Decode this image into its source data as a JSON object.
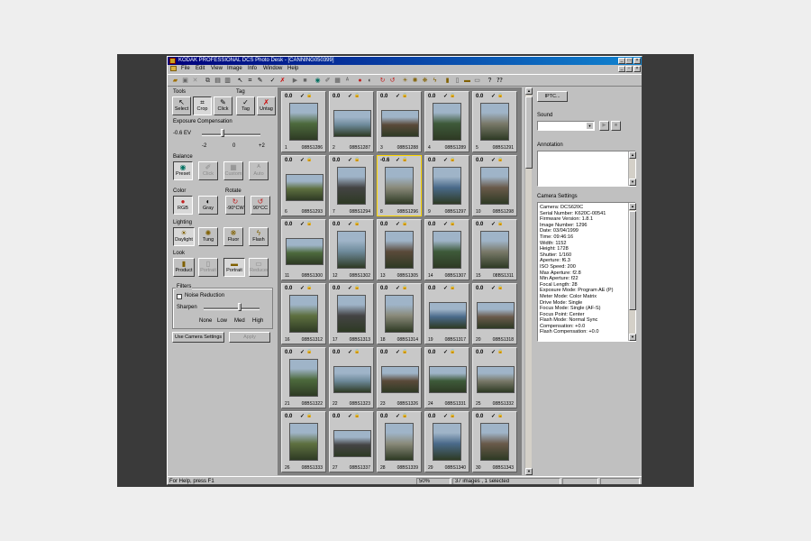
{
  "window": {
    "title": "KODAK PROFESSIONAL DCS Photo Desk - [CANNING050399]"
  },
  "menu": [
    "File",
    "Edit",
    "View",
    "Image",
    "Info",
    "Window",
    "Help"
  ],
  "tools": {
    "tools_label": "Tools",
    "tag_label": "Tag",
    "select": "Select",
    "crop": "Crop",
    "click": "Click",
    "tag": "Tag",
    "untag": "Untag"
  },
  "exposure": {
    "label": "Exposure Compensation",
    "value": "-0.6 EV",
    "ticks": [
      "-2",
      "0",
      "+2"
    ],
    "level": -0.6
  },
  "balance": {
    "label": "Balance",
    "buttons": [
      "Preset",
      "Click",
      "Custom",
      "Auto"
    ]
  },
  "color": {
    "label": "Color",
    "buttons": [
      "RGB",
      "Gray"
    ]
  },
  "rotate": {
    "label": "Rotate",
    "buttons": [
      "-90°CW",
      "90°CC"
    ]
  },
  "lighting": {
    "label": "Lighting",
    "buttons": [
      "Daylight",
      "Tung",
      "Fluor",
      "Flash"
    ]
  },
  "look": {
    "label": "Look",
    "buttons": [
      "Product",
      "Portrait",
      "Portrait",
      "Reduced"
    ]
  },
  "filters": {
    "label": "Filters",
    "noise": "Noise Reduction",
    "sharpen": "Sharpen",
    "levels": [
      "None",
      "Low",
      "Med",
      "High"
    ]
  },
  "actions": {
    "use_camera": "Use Camera Settings",
    "apply": "Apply"
  },
  "thumbnails": [
    {
      "n": "1",
      "f": "08BS1286",
      "ev": "0.0"
    },
    {
      "n": "2",
      "f": "08BS1287",
      "ev": "0.0"
    },
    {
      "n": "3",
      "f": "08BS1288",
      "ev": "0.0"
    },
    {
      "n": "4",
      "f": "08BS1289",
      "ev": "0.0"
    },
    {
      "n": "5",
      "f": "08BS1291",
      "ev": "0.0"
    },
    {
      "n": "6",
      "f": "08BS1293",
      "ev": "0.0"
    },
    {
      "n": "7",
      "f": "08BS1294",
      "ev": "0.0"
    },
    {
      "n": "8",
      "f": "08BS1296",
      "ev": "-0.6"
    },
    {
      "n": "9",
      "f": "08BS1297",
      "ev": "0.0"
    },
    {
      "n": "10",
      "f": "08BS1298",
      "ev": "0.0"
    },
    {
      "n": "11",
      "f": "08BS1300",
      "ev": "0.0"
    },
    {
      "n": "12",
      "f": "08BS1302",
      "ev": "0.0"
    },
    {
      "n": "13",
      "f": "08BS1305",
      "ev": "0.0"
    },
    {
      "n": "14",
      "f": "08BS1307",
      "ev": "0.0"
    },
    {
      "n": "15",
      "f": "08BS1311",
      "ev": "0.0"
    },
    {
      "n": "16",
      "f": "08BS1312",
      "ev": "0.0"
    },
    {
      "n": "17",
      "f": "08BS1313",
      "ev": "0.0"
    },
    {
      "n": "18",
      "f": "08BS1314",
      "ev": "0.0"
    },
    {
      "n": "19",
      "f": "08BS1317",
      "ev": "0.0"
    },
    {
      "n": "20",
      "f": "08BS1318",
      "ev": "0.0"
    },
    {
      "n": "21",
      "f": "08BS1322",
      "ev": "0.0"
    },
    {
      "n": "22",
      "f": "08BS1323",
      "ev": "0.0"
    },
    {
      "n": "23",
      "f": "08BS1326",
      "ev": "0.0"
    },
    {
      "n": "24",
      "f": "08BS1331",
      "ev": "0.0"
    },
    {
      "n": "25",
      "f": "08BS1332",
      "ev": "0.0"
    },
    {
      "n": "26",
      "f": "08BS1333",
      "ev": "0.0"
    },
    {
      "n": "27",
      "f": "08BS1337",
      "ev": "0.0"
    },
    {
      "n": "28",
      "f": "08BS1339",
      "ev": "0.0"
    },
    {
      "n": "29",
      "f": "08BS1340",
      "ev": "0.0"
    },
    {
      "n": "30",
      "f": "08BS1343",
      "ev": "0.0"
    }
  ],
  "selected_index": 8,
  "right": {
    "iptc": "IPTC...",
    "sound": "Sound",
    "annotation": "Annotation",
    "camera_settings": "Camera Settings",
    "settings": [
      "Camera:  DCS620C",
      "Serial Number:  K620C-00541",
      "Firmware Version:  1.8.1",
      "Image Number:  1296",
      "Date:  03/04/1999",
      "Time:  09:46:16",
      "Width:  1152",
      "Height:  1728",
      "Shutter:  1/160",
      "Aperture:  f6.3",
      "ISO Speed:  200",
      "Max Aperture:  f2.8",
      "Min Aperture:  f22",
      "Focal Length:  28",
      "Exposure Mode:  Program AE (P)",
      "Meter Mode:  Color Matrix",
      "Drive Mode:  Single",
      "Focus Mode:  Single (AF-S)",
      "Focus Point:  Center",
      "Flash Mode:  Normal Sync",
      "Compensation:  +0.0",
      "Flash Compensation:  +0.0"
    ]
  },
  "status": {
    "help": "For Help, press F1",
    "zoom": "50%",
    "count": "37 images , 1 selected"
  },
  "colors": {
    "title_start": "#00007b",
    "title_end": "#1084d0",
    "selection": "#ffd800",
    "face": "#c0c0c0"
  }
}
